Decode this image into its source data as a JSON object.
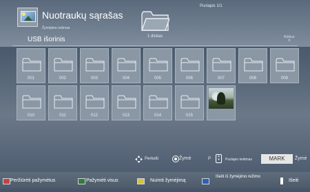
{
  "header": {
    "title": "Nuotraukų sąrašas",
    "mode": "Žymėjimo režimas",
    "page_indicator": "Puslapis 1/1",
    "disk_count": "1 diskas",
    "source": "USB išorinis",
    "sort_label": "Rūšiuo\nti"
  },
  "grid": {
    "folders": [
      "001",
      "002",
      "003",
      "004",
      "005",
      "006",
      "007",
      "008",
      "009",
      "010",
      "011",
      "012",
      "013",
      "014",
      "015"
    ]
  },
  "help": {
    "move": "Perkelti",
    "mark": "Žymė",
    "p_prefix": "P",
    "page_mode": "Puslapio keitimas",
    "mark_button": "MARK",
    "mark_suffix": "Žymė"
  },
  "footer": {
    "view_marked": "Peržiūrėti pažymėtus",
    "mark_all": "Pažymėti visus",
    "unmark_all": "Nuimti žymėjimą",
    "exit_mark": "Išeiti iš žymėjimo režimo",
    "exit": "Išeiti"
  },
  "colors": {
    "red_key": "#c0453f",
    "green_key": "#2e7d3a",
    "yellow_key": "#d6c23a",
    "blue_key": "#2f5fb0"
  }
}
